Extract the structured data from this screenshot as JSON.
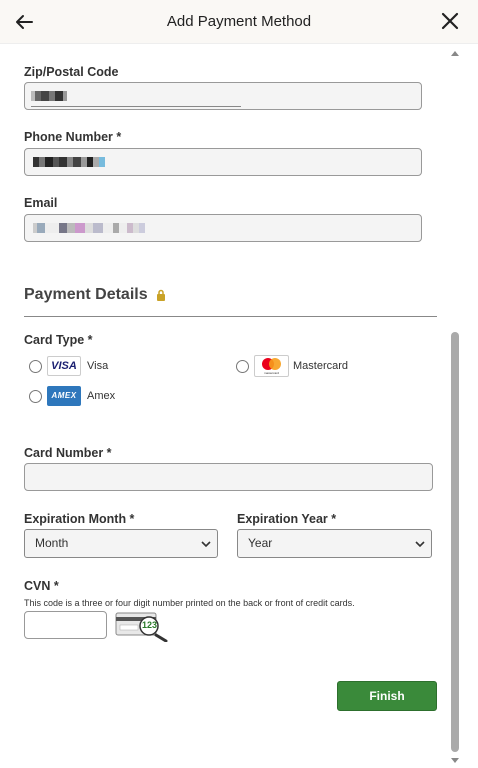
{
  "header": {
    "title": "Add Payment Method",
    "back_icon": "arrow-left-icon",
    "close_icon": "close-icon"
  },
  "form": {
    "zip_label": "Zip/Postal Code",
    "phone_label": "Phone Number *",
    "email_label": "Email",
    "payment_details_title": "Payment Details",
    "card_type_label": "Card Type *",
    "card_types": [
      {
        "label": "Visa",
        "logo": "VISA"
      },
      {
        "label": "Mastercard",
        "logo": "mastercard"
      },
      {
        "label": "Amex",
        "logo": "AMEX"
      }
    ],
    "card_number_label": "Card Number *",
    "exp_month_label": "Expiration Month *",
    "exp_month_value": "Month",
    "exp_year_label": "Expiration Year *",
    "exp_year_value": "Year",
    "cvn_label": "CVN *",
    "cvn_hint": "This code is a three or four digit number printed on the back or front of credit cards.",
    "cvn_example": "123",
    "finish_label": "Finish"
  },
  "colors": {
    "finish_button": "#3a8a3a",
    "lock": "#c9a227"
  }
}
